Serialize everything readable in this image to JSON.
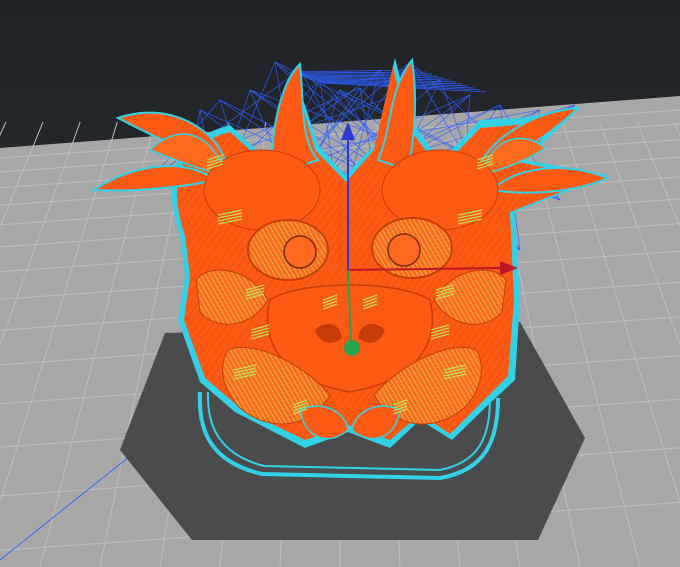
{
  "viewport": {
    "view": "layer-preview",
    "colors": {
      "background": "#2a2e33",
      "build_plate": "#a7a7a7",
      "grid_line": "#bdbdbd",
      "model_shadow": "#4a4b4d",
      "model_fill": "#ff5a14",
      "model_dark": "#c63c06",
      "outer_wall": "#33d1e6",
      "travel_moves": "#2d5fff",
      "infill": "#c9d655",
      "axis_x": "#c0162a",
      "axis_y": "#27a34d",
      "axis_z": "#2a3bd1"
    },
    "icons": {
      "axis_x": "arrow-x-icon",
      "axis_y": "sphere-y-icon",
      "axis_z": "arrow-z-icon"
    }
  }
}
